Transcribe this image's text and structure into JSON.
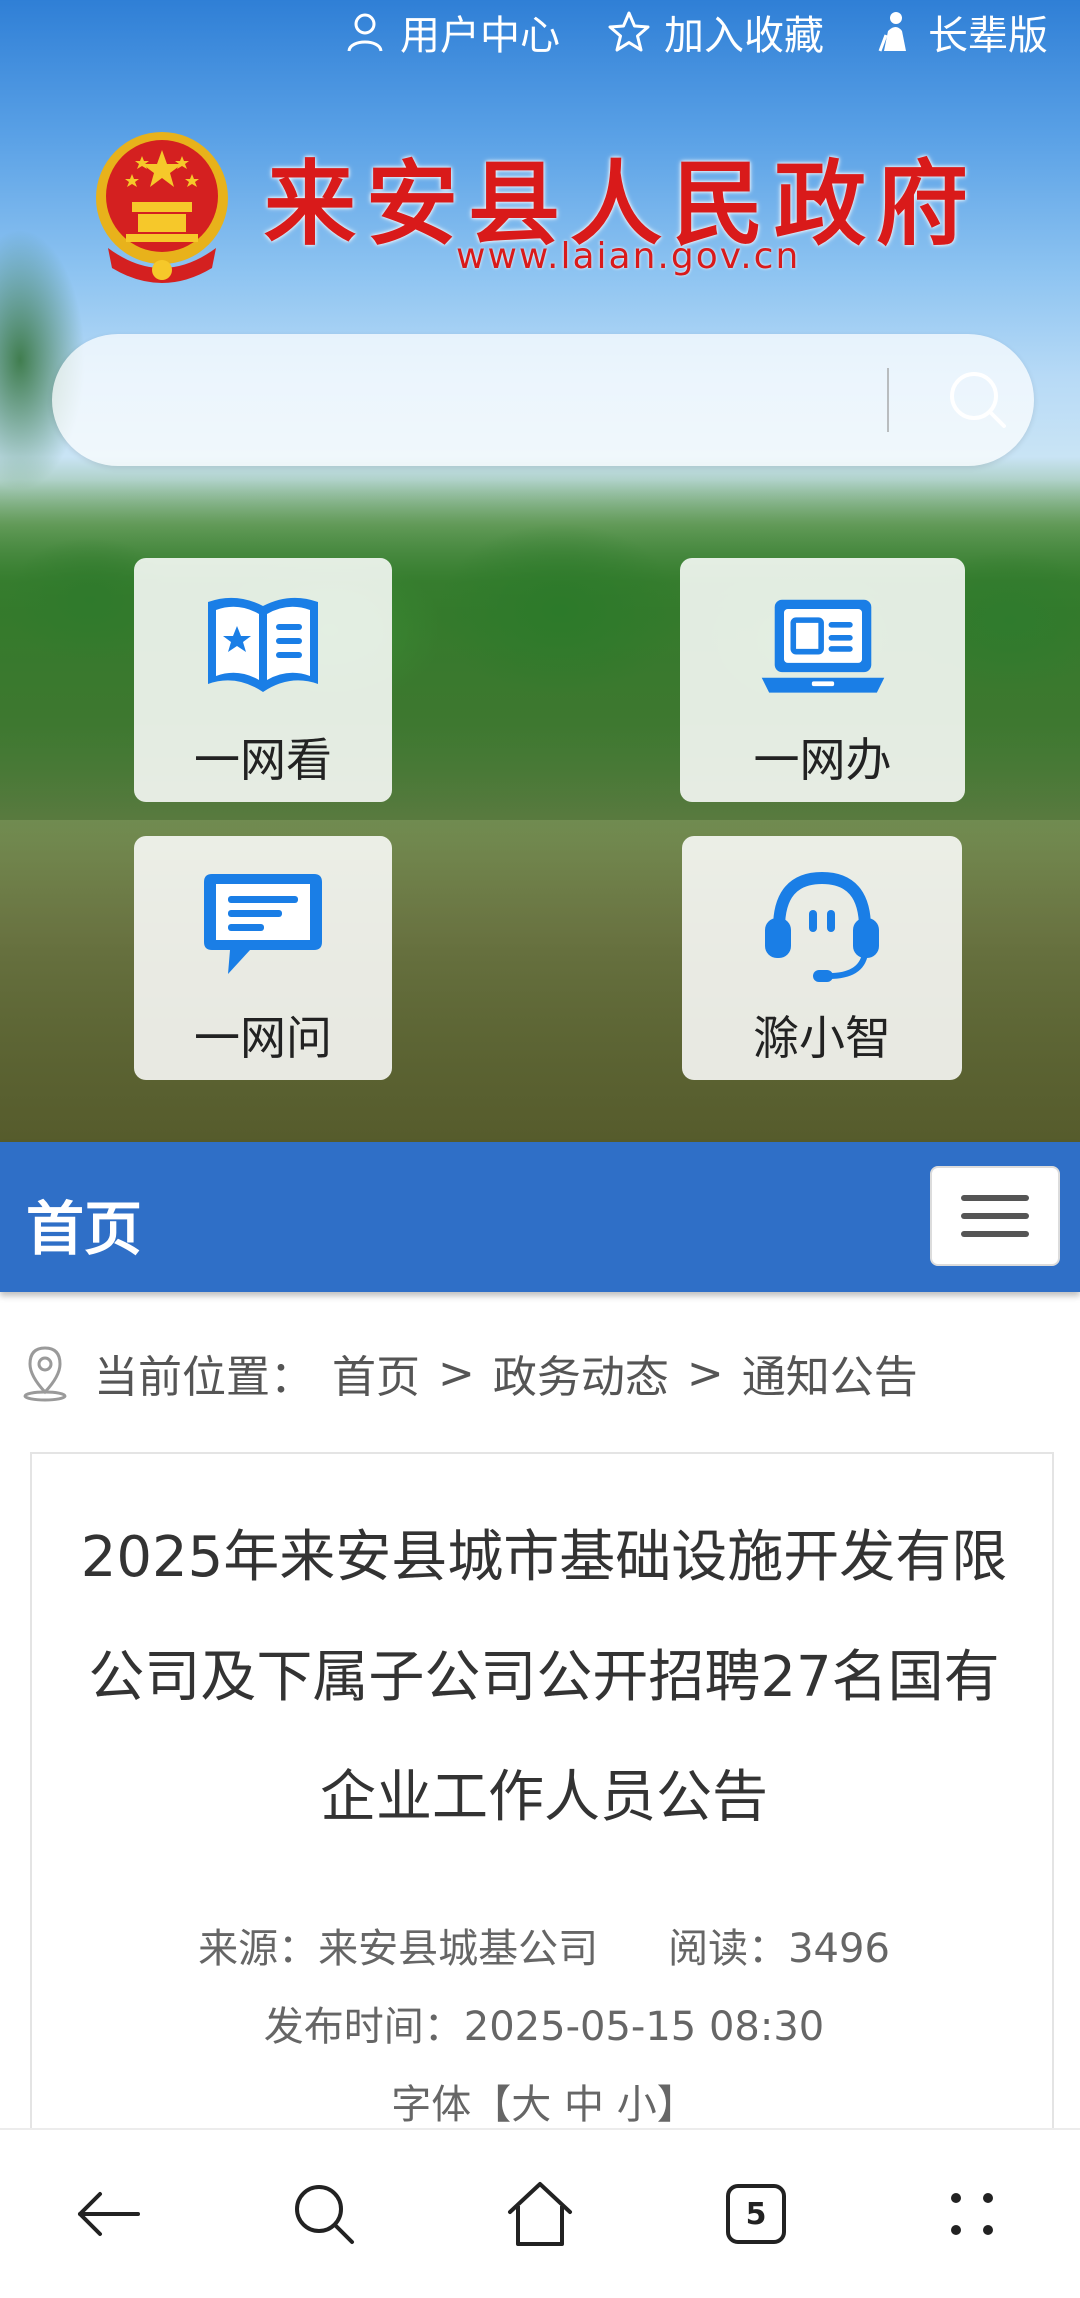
{
  "toplinks": {
    "user_center": "用户中心",
    "favorites": "加入收藏",
    "elder": "长辈版"
  },
  "header": {
    "site_title": "来安县人民政府",
    "site_url": "www.laian.gov.cn"
  },
  "search": {
    "placeholder": ""
  },
  "tiles": [
    {
      "label": "一网看",
      "icon": "book-icon"
    },
    {
      "label": "一网办",
      "icon": "laptop-icon"
    },
    {
      "label": "一网问",
      "icon": "chat-icon"
    },
    {
      "label": "滁小智",
      "icon": "headset-icon"
    }
  ],
  "nav": {
    "title": "首页"
  },
  "breadcrumb": {
    "label": "当前位置：",
    "items": [
      "首页",
      "政务动态",
      "通知公告"
    ],
    "separator": ">"
  },
  "article": {
    "title": "2025年来安县城市基础设施开发有限公司及下属子公司公开招聘27名国有企业工作人员公告",
    "source_label": "来源：",
    "source": "来安县城基公司",
    "reads_label": "阅读：",
    "reads": "3496",
    "published_label": "发布时间：",
    "published": "2025-05-15 08:30",
    "font_label": "字体【大 中 小】"
  },
  "browser_bar": {
    "tab_count": "5"
  },
  "colors": {
    "nav_blue": "#2f6fc7",
    "title_red": "#d91a1a",
    "icon_blue": "#1a7ee6"
  }
}
